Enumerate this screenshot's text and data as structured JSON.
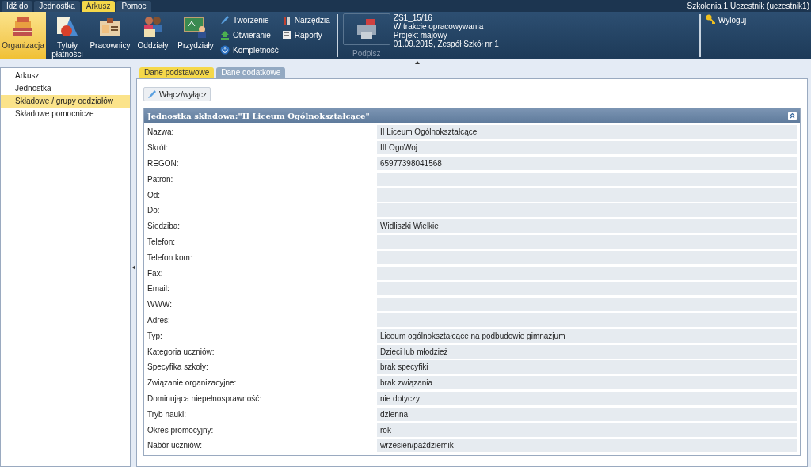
{
  "menu_tabs": [
    {
      "label": "Idź do",
      "selected": false
    },
    {
      "label": "Jednostka",
      "selected": false
    },
    {
      "label": "Arkusz",
      "selected": true
    },
    {
      "label": "Pomoc",
      "selected": false
    }
  ],
  "user": "Szkolenia 1 Uczestnik (uczestnik1)",
  "toolbar": {
    "big_buttons": [
      {
        "label": "Organizacja",
        "kind": "books",
        "selected": true
      },
      {
        "label": "Tytuły płatności",
        "kind": "shapes",
        "selected": false
      },
      {
        "label": "Pracownicy",
        "kind": "badge",
        "selected": false
      },
      {
        "label": "Oddziały",
        "kind": "pupils",
        "selected": false
      },
      {
        "label": "Przydziały",
        "kind": "board",
        "selected": false
      }
    ],
    "small_buttons": [
      [
        {
          "label": "Tworzenie",
          "kind": "pencil"
        },
        {
          "label": "Otwieranie",
          "kind": "upload"
        },
        {
          "label": "Kompletność",
          "kind": "power"
        }
      ],
      [
        {
          "label": "Narzędzia",
          "kind": "tools"
        },
        {
          "label": "Raporty",
          "kind": "report"
        }
      ]
    ],
    "sign": {
      "label": "Podpisz",
      "disabled": true
    },
    "info": [
      "ZS1_15/16",
      "W trakcie opracowywania",
      "Projekt majowy",
      "01.09.2015, Zespół Szkół nr 1"
    ],
    "logout": "Wyloguj"
  },
  "sidebar": {
    "items": [
      {
        "label": "Arkusz",
        "selected": false
      },
      {
        "label": "Jednostka",
        "selected": false
      },
      {
        "label": "Składowe / grupy oddziałów",
        "selected": true
      },
      {
        "label": "Składowe pomocnicze",
        "selected": false
      }
    ]
  },
  "content_tabs": [
    {
      "label": "Dane podstawowe",
      "selected": true
    },
    {
      "label": "Dane dodatkowe",
      "selected": false
    }
  ],
  "toggle_button": "Włącz/wyłącz",
  "panel": {
    "title": "Jednostka składowa:\"II Liceum Ogólnokształcące\"",
    "fields": [
      {
        "label": "Nazwa:",
        "value": "II Liceum Ogólnokształcące"
      },
      {
        "label": "Skrót:",
        "value": "IILOgoWoj"
      },
      {
        "label": "REGON:",
        "value": "65977398041568"
      },
      {
        "label": "Patron:"
      },
      {
        "label": "Od:"
      },
      {
        "label": "Do:"
      },
      {
        "label": "Siedziba:",
        "value": "Widliszki Wielkie"
      },
      {
        "label": "Telefon:"
      },
      {
        "label": "Telefon kom:"
      },
      {
        "label": "Fax:"
      },
      {
        "label": "Email:"
      },
      {
        "label": "WWW:"
      },
      {
        "label": "Adres:"
      },
      {
        "label": "Typ:",
        "value": "Liceum ogólnokształcące na podbudowie gimnazjum"
      },
      {
        "label": "Kategoria uczniów:",
        "value": "Dzieci lub młodzież"
      },
      {
        "label": "Specyfika szkoły:",
        "value": "brak specyfiki"
      },
      {
        "label": "Związanie organizacyjne:",
        "value": "brak związania"
      },
      {
        "label": "Dominująca niepełnosprawność:",
        "value": "nie dotyczy"
      },
      {
        "label": "Tryb nauki:",
        "value": "dzienna"
      },
      {
        "label": "Okres promocyjny:",
        "value": "rok"
      },
      {
        "label": "Nabór uczniów:",
        "value": "wrzesień/październik"
      }
    ]
  }
}
